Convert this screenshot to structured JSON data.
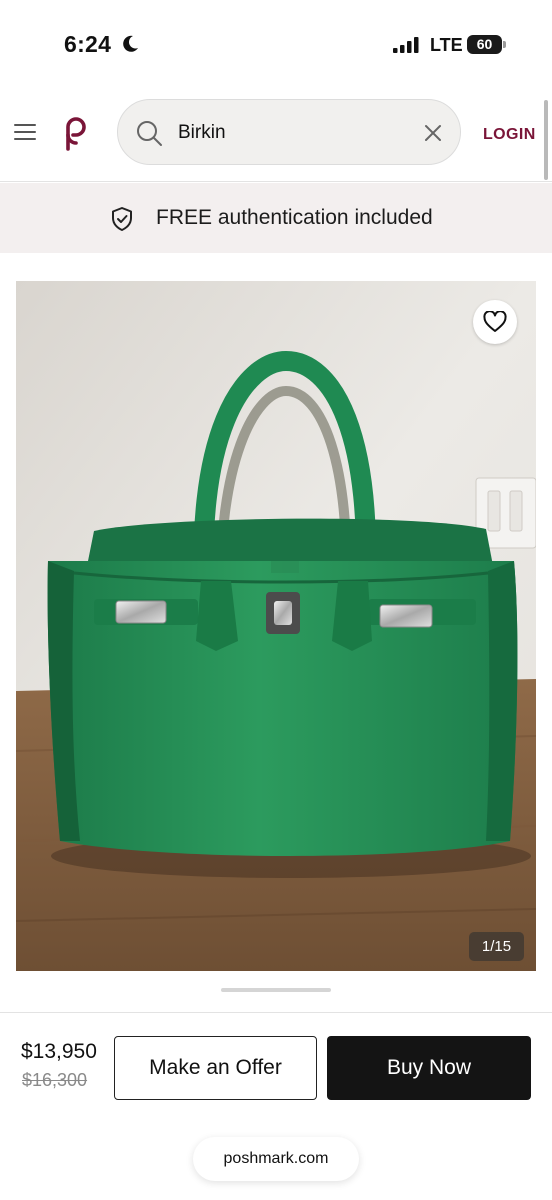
{
  "status_bar": {
    "time": "6:24",
    "network": "LTE",
    "battery": "60"
  },
  "header": {
    "search": {
      "value": "Birkin",
      "placeholder": "Search"
    },
    "login_label": "LOGIN",
    "brand_color": "#7a1538"
  },
  "banner": {
    "text": "FREE authentication included"
  },
  "product": {
    "image_counter": "1/15",
    "icons": [
      "heart-icon"
    ]
  },
  "purchase": {
    "price": "$13,950",
    "original_price": "$16,300",
    "offer_label": "Make an Offer",
    "buy_label": "Buy Now"
  },
  "browser": {
    "url": "poshmark.com"
  }
}
